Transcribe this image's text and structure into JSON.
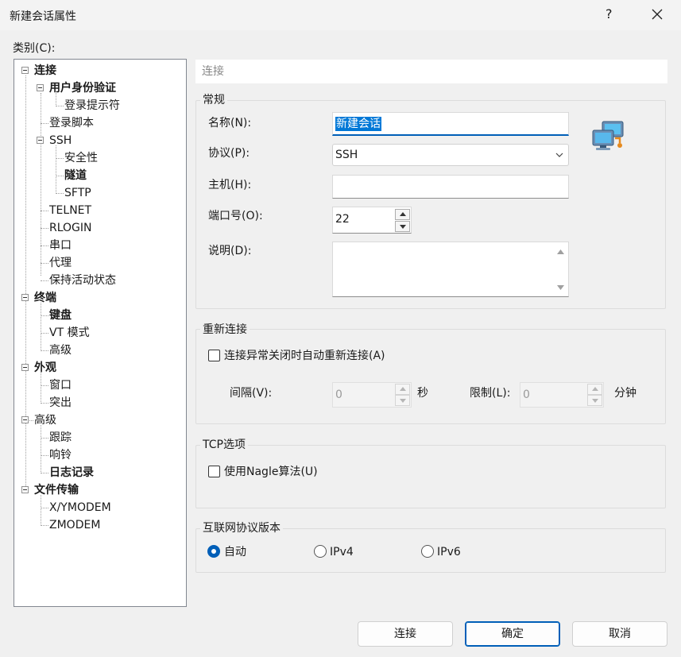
{
  "window": {
    "title": "新建会话属性",
    "help_label": "?"
  },
  "category_label": "类别(C):",
  "tree": {
    "connection": "连接",
    "user_auth": "用户身份验证",
    "login_prompt": "登录提示符",
    "login_script": "登录脚本",
    "ssh": "SSH",
    "security": "安全性",
    "tunnel": "隧道",
    "sftp": "SFTP",
    "telnet": "TELNET",
    "rlogin": "RLOGIN",
    "serial": "串口",
    "proxy": "代理",
    "keepalive": "保持活动状态",
    "terminal": "终端",
    "keyboard": "键盘",
    "vt_mode": "VT 模式",
    "terminal_advanced": "高级",
    "appearance": "外观",
    "window": "窗口",
    "highlight": "突出",
    "advanced": "高级",
    "trace": "跟踪",
    "bell": "响铃",
    "logging": "日志记录",
    "file_transfer": "文件传输",
    "xymodem": "X/YMODEM",
    "zmodem": "ZMODEM"
  },
  "header": {
    "title": "连接"
  },
  "general": {
    "title": "常规",
    "name_label": "名称(N):",
    "name_value": "新建会话",
    "protocol_label": "协议(P):",
    "protocol_value": "SSH",
    "host_label": "主机(H):",
    "host_value": "",
    "port_label": "端口号(O):",
    "port_value": "22",
    "description_label": "说明(D):",
    "description_value": ""
  },
  "reconnect": {
    "title": "重新连接",
    "auto_reconnect_label": "连接异常关闭时自动重新连接(A)",
    "interval_label": "间隔(V):",
    "interval_value": "0",
    "interval_unit": "秒",
    "limit_label": "限制(L):",
    "limit_value": "0",
    "limit_unit": "分钟"
  },
  "tcp": {
    "title": "TCP选项",
    "nagle_label": "使用Nagle算法(U)"
  },
  "ip_version": {
    "title": "互联网协议版本",
    "auto_label": "自动",
    "ipv4_label": "IPv4",
    "ipv6_label": "IPv6",
    "selected": "自动"
  },
  "buttons": {
    "connect": "连接",
    "ok": "确定",
    "cancel": "取消"
  },
  "colors": {
    "accent": "#005fb8",
    "selection": "#0078d7"
  }
}
